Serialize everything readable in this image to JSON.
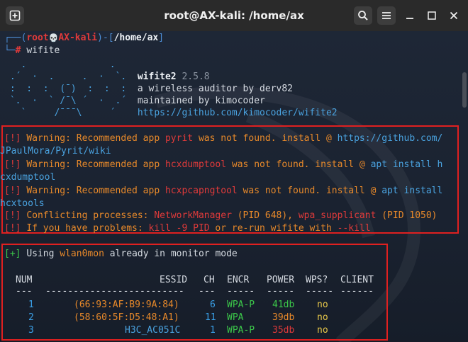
{
  "window": {
    "title": "root@AX-kali: /home/ax"
  },
  "prompt": {
    "open": "┌──(",
    "user": "root",
    "skull": "💀",
    "host": "AX-kali",
    "mid": ")-[",
    "path": "/home/ax",
    "close": "]",
    "corner": "└─",
    "hash": "# ",
    "command": "wifite"
  },
  "banner": {
    "art": [
      "   .               .    ",
      " .´  ·  .     .  ·  `.  ",
      " :  :  :  (¯)  :  :  :  ",
      " `.  ·  ` /¯\\ ´  ·  .´  ",
      "   `     /¯¯¯\\     ´    "
    ],
    "name": "wifite2",
    "version": "2.5.8",
    "tagline": "a wireless auditor by derv82",
    "maintainer": "maintained by kimocoder",
    "url": "https://github.com/kimocoder/wifite2"
  },
  "warnings": [
    {
      "tag": "!",
      "pre": "Warning: Recommended app ",
      "app": "pyrit",
      "mid": " was not found. install @ ",
      "link1": "https://github.com/",
      "link2": "JPaulMora/Pyrit/wiki"
    },
    {
      "tag": "!",
      "pre": "Warning: Recommended app ",
      "app": "hcxdumptool",
      "mid": " was not found. install @ ",
      "link1": "apt install h",
      "link2": "cxdumptool"
    },
    {
      "tag": "!",
      "pre": "Warning: Recommended app ",
      "app": "hcxpcapngtool",
      "mid": " was not found. install @ ",
      "link1": "apt install",
      "link2": "hcxtools"
    }
  ],
  "conflict": {
    "tag": "!",
    "pre": "Conflicting processes: ",
    "p1": "NetworkManager",
    "p1pid": " (PID 648), ",
    "p2": "wpa_supplicant",
    "p2pid": " (PID 1050)"
  },
  "problems": {
    "tag": "!",
    "pre": "If you have problems: ",
    "cmd1": "kill -9 PID",
    "mid": " or re-run wifite with ",
    "cmd2": "--kill"
  },
  "monitor": {
    "tag": "+",
    "pre": "Using ",
    "iface": "wlan0mon",
    "post": " already in monitor mode"
  },
  "table": {
    "headers": {
      "num": "NUM",
      "essid": "ESSID",
      "ch": "CH",
      "encr": "ENCR",
      "power": "POWER",
      "wps": "WPS?",
      "client": "CLIENT"
    },
    "sep": {
      "num": "---",
      "essid": "-------------------------",
      "ch": "---",
      "encr": "-----",
      "power": "-----",
      "wps": "-----",
      "client": "------"
    },
    "rows": [
      {
        "num": "1",
        "essid": "(66:93:AF:B9:9A:84)",
        "ch": "6",
        "encr": "WPA-P",
        "power": "41db",
        "wps": "no"
      },
      {
        "num": "2",
        "essid": "(58:60:5F:D5:48:A1)",
        "ch": "11",
        "encr": "WPA",
        "power": "39db",
        "wps": "no"
      },
      {
        "num": "3",
        "essid": "H3C_AC051C",
        "ch": "1",
        "encr": "WPA-P",
        "power": "35db",
        "wps": "no"
      }
    ]
  }
}
